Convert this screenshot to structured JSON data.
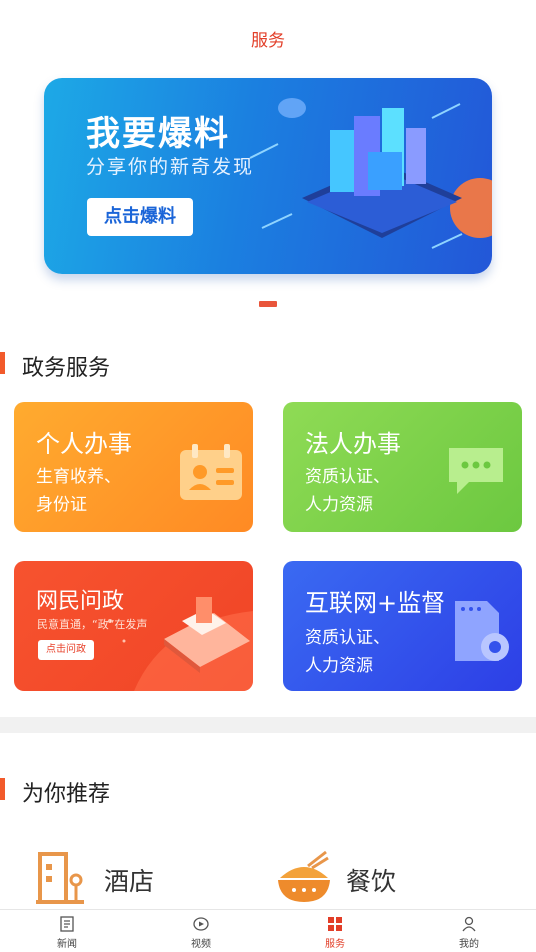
{
  "header": {
    "title": "服务"
  },
  "banner": {
    "headline": "我要爆料",
    "subline": "分享你的新奇发现",
    "button": "点击爆料"
  },
  "section_gov": {
    "title": "政务服务"
  },
  "cards": [
    {
      "title": "个人办事",
      "line1": "生育收养、",
      "line2": "身份证",
      "color": "#ff9a28"
    },
    {
      "title": "法人办事",
      "line1": "资质认证、",
      "line2": "人力资源",
      "color": "#7ed04a"
    },
    {
      "title": "网民问政",
      "slogan": "民意直通，“政”在发声",
      "button": "点击问政",
      "color": "#f34b2a"
    },
    {
      "title": "互联网+监督",
      "line1": "资质认证、",
      "line2": "人力资源",
      "color": "#3352ec"
    }
  ],
  "section_rec": {
    "title": "为你推荐"
  },
  "recommend": [
    {
      "label": "酒店",
      "icon": "hotel-icon"
    },
    {
      "label": "餐饮",
      "icon": "food-bowl-icon"
    }
  ],
  "tabs": [
    {
      "label": "新闻",
      "icon": "news-icon",
      "active": false
    },
    {
      "label": "视频",
      "icon": "video-icon",
      "active": false
    },
    {
      "label": "服务",
      "icon": "service-grid-icon",
      "active": true
    },
    {
      "label": "我的",
      "icon": "user-icon",
      "active": false
    }
  ],
  "colors": {
    "accent": "#e23e28",
    "section_bar": "#f25a2b"
  }
}
